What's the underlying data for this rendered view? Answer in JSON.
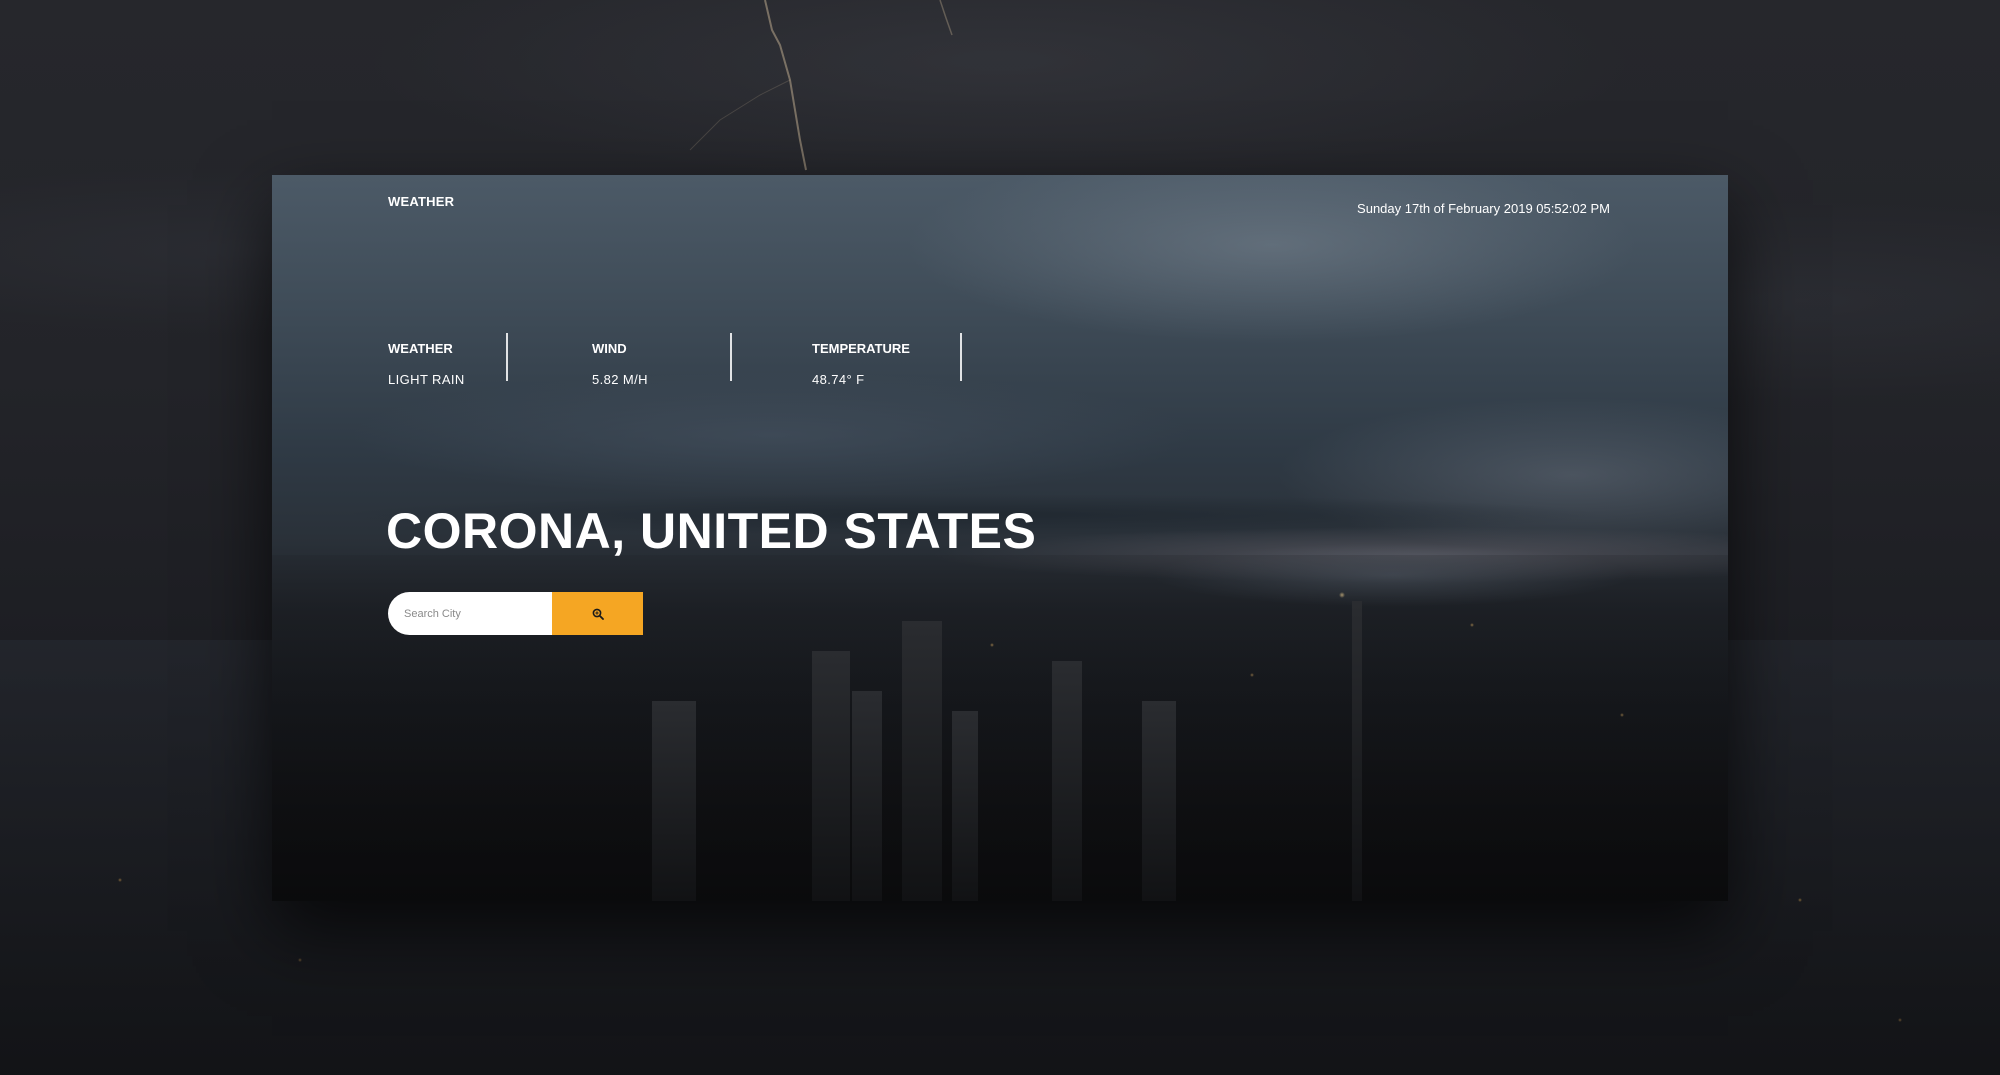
{
  "app": {
    "brand": "WEATHER",
    "datetime": "Sunday 17th of February 2019 05:52:02 PM"
  },
  "stats": [
    {
      "label": "WEATHER",
      "value": "LIGHT RAIN"
    },
    {
      "label": "WIND",
      "value": "5.82 M/H"
    },
    {
      "label": "TEMPERATURE",
      "value": "48.74° F"
    }
  ],
  "location": {
    "title": "CORONA, UNITED STATES"
  },
  "search": {
    "placeholder": "Search City",
    "value": "",
    "button_icon": "search-icon"
  },
  "colors": {
    "accent": "#f5a623",
    "text": "#ffffff",
    "background": "#1e1f24"
  }
}
